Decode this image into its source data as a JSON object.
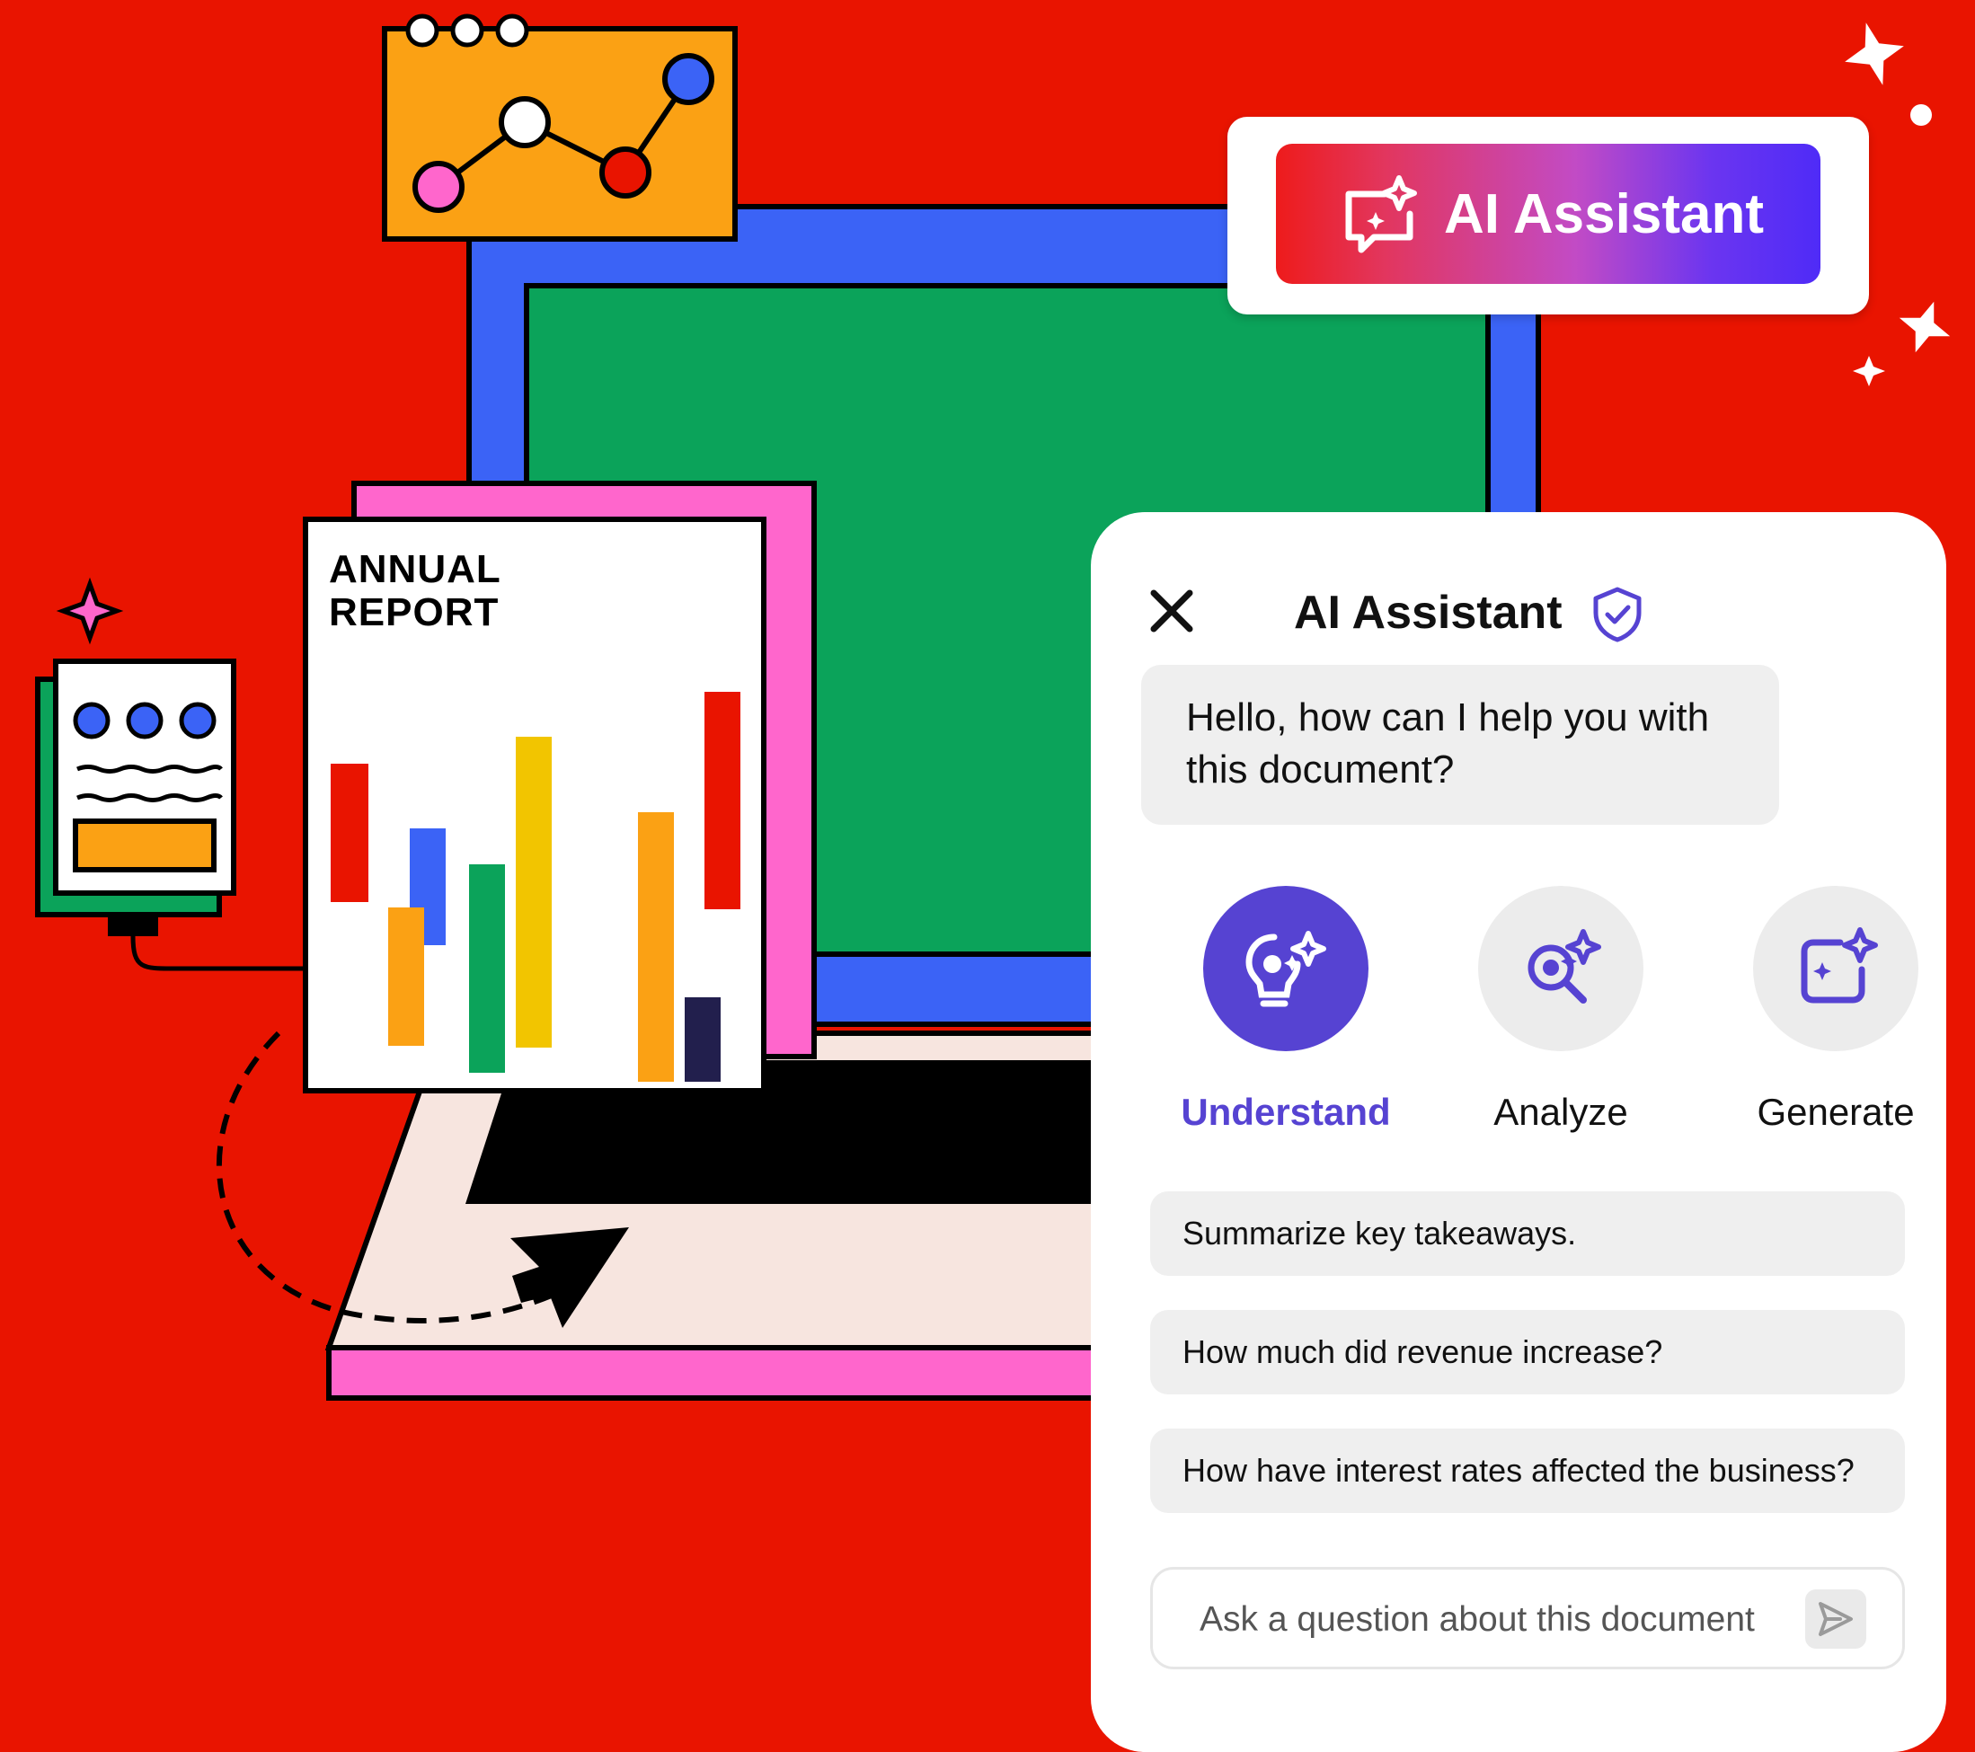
{
  "badge": {
    "label": "AI Assistant",
    "icon": "ai-chat-sparkle-icon"
  },
  "panel": {
    "title": "AI Assistant",
    "close_icon": "close-icon",
    "verified_icon": "shield-check-icon",
    "greeting": "Hello, how can I help you with this document?",
    "modes": [
      {
        "label": "Understand",
        "icon": "lightbulb-sparkle-icon",
        "active": true
      },
      {
        "label": "Analyze",
        "icon": "magnifier-sparkle-icon",
        "active": false
      },
      {
        "label": "Generate",
        "icon": "square-sparkle-icon",
        "active": false
      }
    ],
    "suggestions": [
      "Summarize key takeaways.",
      "How much did revenue increase?",
      "How have interest rates affected the business?"
    ],
    "input": {
      "placeholder": "Ask a question about this document",
      "value": ""
    },
    "send_icon": "send-icon"
  },
  "report": {
    "title_line1": "ANNUAL",
    "title_line2": "REPORT"
  },
  "colors": {
    "background": "#e91400",
    "accent": "#5643d2",
    "laptop_screen": "#0ba35a",
    "laptop_frame": "#3b63f6",
    "doc_back": "#ff66cc",
    "chart_card": "#fba114"
  }
}
